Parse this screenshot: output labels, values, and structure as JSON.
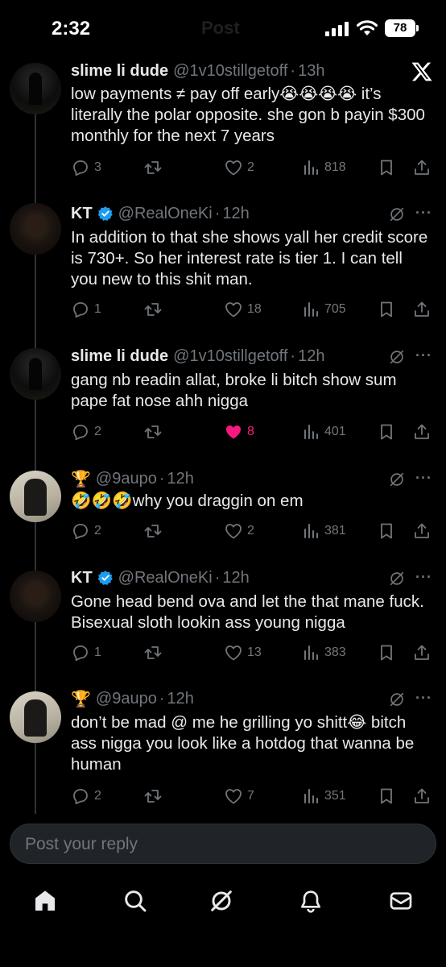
{
  "status_bar": {
    "time": "2:32",
    "faded_title": "Post",
    "battery": "78"
  },
  "tweets": [
    {
      "name": "slime li dude",
      "handle": "@1v10stillgetoff",
      "time": "13h",
      "verified": false,
      "text": "low payments ≠ pay off early😭😭😭😭 it’s literally the polar opposite. she gon b payin $300 monthly for the next 7 years",
      "replies": "3",
      "reposts": "",
      "likes": "2",
      "views": "818",
      "liked": false
    },
    {
      "name": "KT",
      "handle": "@RealOneKi",
      "time": "12h",
      "verified": true,
      "text": "In addition to that she shows yall her credit score is 730+. So her interest rate is tier 1. I can tell you new to this shit man.",
      "replies": "1",
      "reposts": "",
      "likes": "18",
      "views": "705",
      "liked": false
    },
    {
      "name": "slime li dude",
      "handle": "@1v10stillgetoff",
      "time": "12h",
      "verified": false,
      "text": "gang nb readin allat, broke li bitch show sum pape fat nose ahh nigga",
      "replies": "2",
      "reposts": "",
      "likes": "8",
      "views": "401",
      "liked": true
    },
    {
      "name": "🏆",
      "handle": "@9aupo",
      "time": "12h",
      "verified": false,
      "text": "🤣🤣🤣why you draggin on em",
      "replies": "2",
      "reposts": "",
      "likes": "2",
      "views": "381",
      "liked": false
    },
    {
      "name": "KT",
      "handle": "@RealOneKi",
      "time": "12h",
      "verified": true,
      "text": "Gone head bend ova and let the that mane fuck. Bisexual sloth lookin ass young nigga",
      "replies": "1",
      "reposts": "",
      "likes": "13",
      "views": "383",
      "liked": false
    },
    {
      "name": "🏆",
      "handle": "@9aupo",
      "time": "12h",
      "verified": false,
      "text": "don’t be mad @ me he grilling yo shitt😂 bitch ass nigga you look like a hotdog that wanna be human",
      "replies": "2",
      "reposts": "",
      "likes": "7",
      "views": "351",
      "liked": false
    }
  ],
  "reply": {
    "placeholder": "Post your reply"
  },
  "icons": {
    "reply": "reply-icon",
    "repost": "repost-icon",
    "like": "heart-icon",
    "views": "views-icon",
    "bookmark": "bookmark-icon",
    "share": "share-icon",
    "grok": "grok-icon",
    "more": "more-icon"
  },
  "colors": {
    "background": "#000000",
    "text": "#e7e9ea",
    "muted": "#71767b",
    "verified": "#1d9bf0",
    "like_active": "#f91880"
  }
}
